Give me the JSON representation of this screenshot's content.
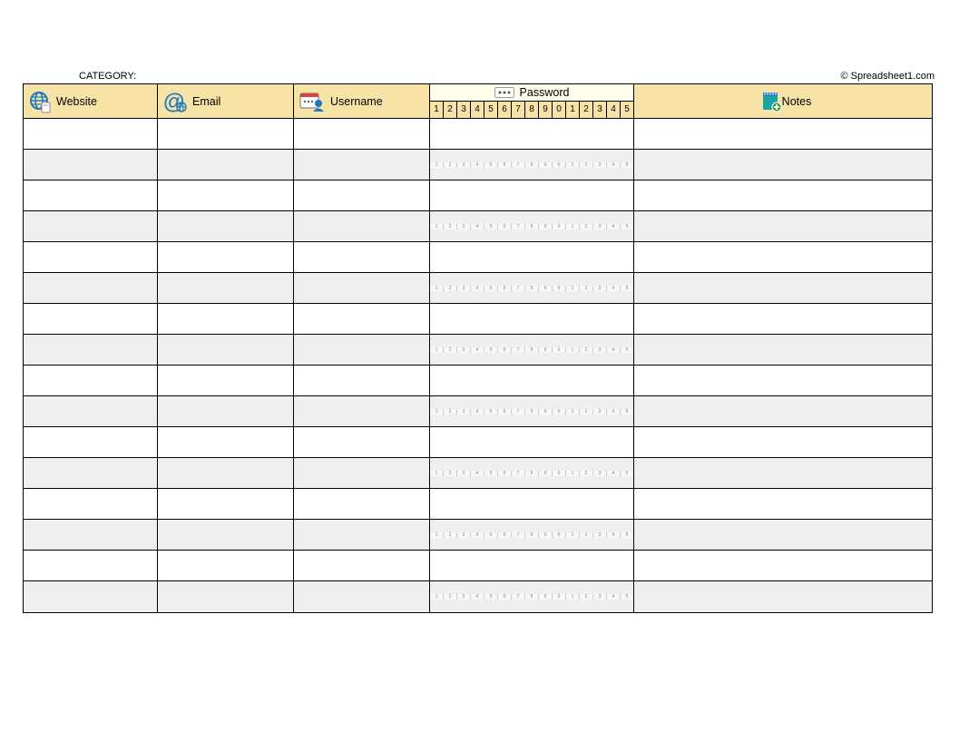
{
  "topbar": {
    "category_label": "CATEGORY:",
    "copyright": "© Spreadsheet1.com"
  },
  "headers": {
    "website": "Website",
    "email": "Email",
    "username": "Username",
    "password": "Password",
    "notes": "Notes"
  },
  "password_cells": [
    "1",
    "2",
    "3",
    "4",
    "5",
    "6",
    "7",
    "8",
    "9",
    "0",
    "1",
    "2",
    "3",
    "4",
    "5"
  ],
  "row_count": 16,
  "ghost_rows": [
    2,
    4,
    6,
    8,
    10,
    12,
    14,
    16
  ],
  "colors": {
    "header_bg": "#f8e3a6",
    "stripe_bg": "#efefef",
    "icon_blue": "#1f77c2",
    "icon_teal": "#1aa3a3",
    "icon_red": "#d9453a"
  }
}
